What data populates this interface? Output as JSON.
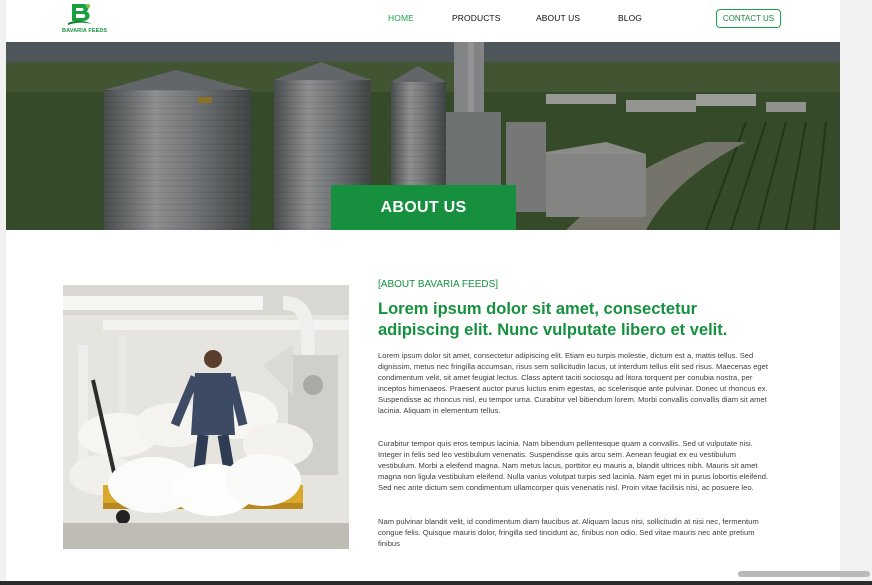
{
  "header": {
    "logo_text": "BAVARIA FEEDS",
    "nav": [
      {
        "label": "HOME",
        "active": true
      },
      {
        "label": "PRODUCTS",
        "active": false
      },
      {
        "label": "ABOUT US",
        "active": false
      },
      {
        "label": "BLOG",
        "active": false
      }
    ],
    "contact_label": "CONTACT US"
  },
  "hero": {
    "title": "ABOUT US"
  },
  "about": {
    "eyebrow": "[ABOUT BAVARIA FEEDS]",
    "headline": "Lorem ipsum dolor sit amet, consectetur adipiscing elit. Nunc vulputate libero et velit.",
    "paragraphs": [
      "Lorem ipsum dolor sit amet, consectetur adipiscing elit. Etiam eu turpis molestie, dictum est a, mattis tellus. Sed dignissim, metus nec fringilla accumsan, risus sem sollicitudin lacus, ut interdum tellus elit sed risus. Maecenas eget condimentum velit, sit amet feugiat lectus. Class aptent taciti sociosqu ad litora torquent per conubia nostra, per inceptos himenaeos. Praesent auctor purus luctus enim egestas, ac scelerisque ante pulvinar. Donec ut rhoncus ex. Suspendisse ac rhoncus nisl, eu tempor urna. Curabitur vel bibendum lorem. Morbi convallis convallis diam sit amet lacinia. Aliquam in elementum tellus.",
      "Curabitur tempor quis eros tempus lacinia. Nam bibendum pellentesque quam a convallis. Sed ut vulputate nisi. Integer in felis sed leo vestibulum venenatis. Suspendisse quis arcu sem. Aenean feugiat ex eu vestibulum vestibulum. Morbi a eleifend magna. Nam metus lacus, porttitor eu mauris a, blandit ultrices nibh. Mauris sit amet magna non ligula vestibulum eleifend. Nulla varius volutpat turpis sed lacinia. Nam eget mi in purus lobortis eleifend. Sed nec ante dictum sem condimentum ullamcorper quis venenatis nisl. Proin vitae facilisis nisi, ac posuere leo.",
      "Nam pulvinar blandit velit, id condimentum diam faucibus at. Aliquam lacus nisi, sollicitudin at nisi nec, fermentum congue felis. Quisque mauris dolor, fringilla sed tincidunt ac, finibus non odio. Sed vitae mauris nec ante pretium finibus"
    ]
  },
  "colors": {
    "brand_green": "#16913f",
    "nav_active": "#16a34a",
    "body_text": "#3f3f3f"
  },
  "icons": {
    "logo": "b-letter-logo-icon"
  }
}
